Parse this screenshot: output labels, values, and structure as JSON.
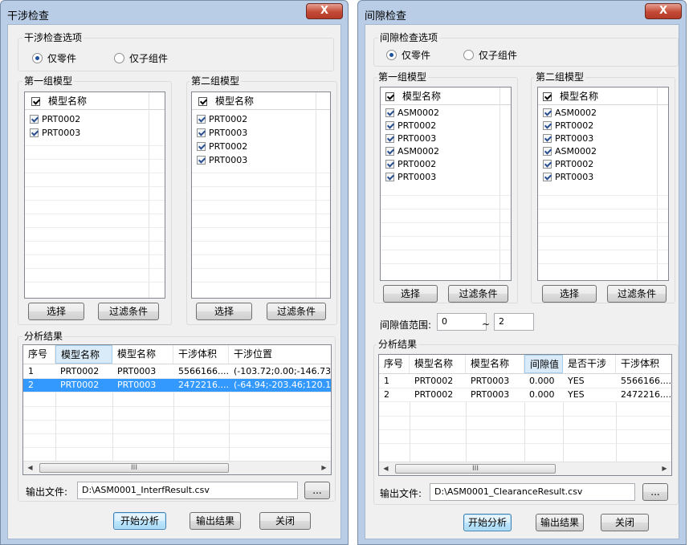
{
  "left": {
    "title": "干涉检查",
    "close_glyph": "X",
    "options_group": "干涉检查选项",
    "radio_parts": "仅零件",
    "radio_assemblies": "仅子组件",
    "group1_title": "第一组模型",
    "group2_title": "第二组模型",
    "col_model_name": "模型名称",
    "group1_items": [
      "PRT0002",
      "PRT0003"
    ],
    "group2_items": [
      "PRT0002",
      "PRT0003",
      "PRT0002",
      "PRT0003"
    ],
    "select_btn": "选择",
    "filter_btn": "过滤条件",
    "results_group": "分析结果",
    "result_headers": [
      "序号",
      "模型名称",
      "模型名称",
      "干涉体积",
      "干涉位置"
    ],
    "result_rows": [
      [
        "1",
        "PRT0002",
        "PRT0003",
        "5566166....",
        "(-103.72;0.00;-146.73) ("
      ],
      [
        "2",
        "PRT0002",
        "PRT0003",
        "2472216....",
        "(-64.94;-203.46;120.19)"
      ]
    ],
    "scroll_thumb": "III",
    "output_label": "输出文件:",
    "output_path": "D:\\ASM0001_InterfResult.csv",
    "browse_btn": "...",
    "start_btn": "开始分析",
    "export_btn": "输出结果",
    "close_btn": "关闭"
  },
  "right": {
    "title": "间隙检查",
    "close_glyph": "X",
    "options_group": "间隙检查选项",
    "radio_parts": "仅零件",
    "radio_assemblies": "仅子组件",
    "group1_title": "第一组模型",
    "group2_title": "第二组模型",
    "col_model_name": "模型名称",
    "group1_items": [
      "ASM0002",
      "PRT0002",
      "PRT0003",
      "ASM0002",
      "PRT0002",
      "PRT0003"
    ],
    "group2_items": [
      "ASM0002",
      "PRT0002",
      "PRT0003",
      "ASM0002",
      "PRT0002",
      "PRT0003"
    ],
    "select_btn": "选择",
    "filter_btn": "过滤条件",
    "range_label": "间隙值范围:",
    "range_min": "0",
    "range_sep": "~",
    "range_max": "2",
    "results_group": "分析结果",
    "result_headers": [
      "序号",
      "模型名称",
      "模型名称",
      "间隙值",
      "是否干涉",
      "干涉体积"
    ],
    "result_rows": [
      [
        "1",
        "PRT0002",
        "PRT0003",
        "0.000",
        "YES",
        "5566166...."
      ],
      [
        "2",
        "PRT0002",
        "PRT0003",
        "0.000",
        "YES",
        "2472216...."
      ]
    ],
    "scroll_thumb": "III",
    "output_label": "输出文件:",
    "output_path": "D:\\ASM0001_ClearanceResult.csv",
    "browse_btn": "...",
    "start_btn": "开始分析",
    "export_btn": "输出结果",
    "close_btn": "关闭"
  }
}
